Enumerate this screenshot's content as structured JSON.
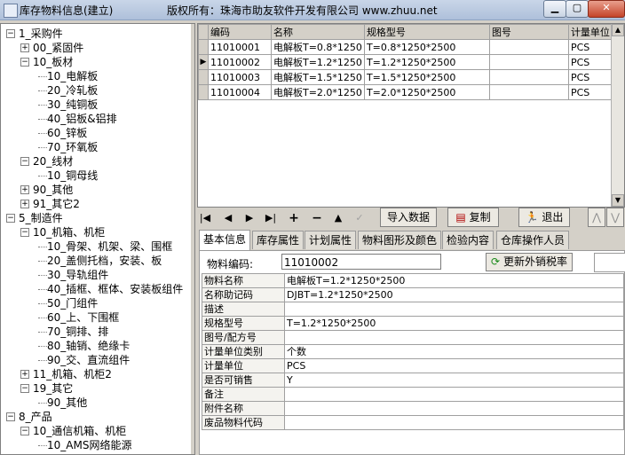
{
  "window": {
    "title": "库存物料信息(建立)",
    "copyright": "版权所有：珠海市助友软件开发有限公司 www.zhuu.net",
    "min": "▁",
    "max": "▢",
    "close": "✕"
  },
  "tree": [
    {
      "label": "1_采购件",
      "level": 0,
      "expander": "−"
    },
    {
      "label": "00_紧固件",
      "level": 1,
      "expander": "+"
    },
    {
      "label": "10_板材",
      "level": 1,
      "expander": "−"
    },
    {
      "label": "10_电解板",
      "level": 2,
      "expander": ""
    },
    {
      "label": "20_冷轧板",
      "level": 2,
      "expander": ""
    },
    {
      "label": "30_纯铜板",
      "level": 2,
      "expander": ""
    },
    {
      "label": "40_铝板&铝排",
      "level": 2,
      "expander": ""
    },
    {
      "label": "60_锌板",
      "level": 2,
      "expander": ""
    },
    {
      "label": "70_环氧板",
      "level": 2,
      "expander": ""
    },
    {
      "label": "20_线材",
      "level": 1,
      "expander": "−"
    },
    {
      "label": "10_铜母线",
      "level": 2,
      "expander": ""
    },
    {
      "label": "90_其他",
      "level": 1,
      "expander": "+"
    },
    {
      "label": "91_其它2",
      "level": 1,
      "expander": "+"
    },
    {
      "label": "5_制造件",
      "level": 0,
      "expander": "−"
    },
    {
      "label": "10_机箱、机柜",
      "level": 1,
      "expander": "−"
    },
    {
      "label": "10_骨架、机架、梁、围框",
      "level": 2,
      "expander": ""
    },
    {
      "label": "20_盖侧托档，安装、板",
      "level": 2,
      "expander": ""
    },
    {
      "label": "30_导轨组件",
      "level": 2,
      "expander": ""
    },
    {
      "label": "40_插框、框体、安装板组件",
      "level": 2,
      "expander": ""
    },
    {
      "label": "50_门组件",
      "level": 2,
      "expander": ""
    },
    {
      "label": "60_上、下围框",
      "level": 2,
      "expander": ""
    },
    {
      "label": "70_铜排、排",
      "level": 2,
      "expander": ""
    },
    {
      "label": "80_轴销、绝缘卡",
      "level": 2,
      "expander": ""
    },
    {
      "label": "90_交、直流组件",
      "level": 2,
      "expander": ""
    },
    {
      "label": "11_机箱、机柜2",
      "level": 1,
      "expander": "+"
    },
    {
      "label": "19_其它",
      "level": 1,
      "expander": "−"
    },
    {
      "label": "90_其他",
      "level": 2,
      "expander": ""
    },
    {
      "label": "8_产品",
      "level": 0,
      "expander": "−"
    },
    {
      "label": "10_通信机箱、机柜",
      "level": 1,
      "expander": "−"
    },
    {
      "label": "10_AMS网络能源",
      "level": 2,
      "expander": ""
    }
  ],
  "grid": {
    "columns": [
      "编码",
      "名称",
      "规格型号",
      "图号",
      "计量单位"
    ],
    "rows": [
      {
        "indicator": "",
        "cells": [
          "11010001",
          "电解板T=0.8*1250",
          "T=0.8*1250*2500",
          "",
          "PCS"
        ]
      },
      {
        "indicator": "▶",
        "cells": [
          "11010002",
          "电解板T=1.2*1250",
          "T=1.2*1250*2500",
          "",
          "PCS"
        ]
      },
      {
        "indicator": "",
        "cells": [
          "11010003",
          "电解板T=1.5*1250",
          "T=1.5*1250*2500",
          "",
          "PCS"
        ]
      },
      {
        "indicator": "",
        "cells": [
          "11010004",
          "电解板T=2.0*1250",
          "T=2.0*1250*2500",
          "",
          "PCS"
        ]
      }
    ]
  },
  "nav": {
    "first": "|◀",
    "prev": "◀",
    "next": "▶",
    "last": "▶|",
    "add": "+",
    "del": "−",
    "up": "▲",
    "check": "✓",
    "import": "导入数据",
    "copy": "复制",
    "exit": "退出"
  },
  "tabs": [
    "基本信息",
    "库存属性",
    "计划属性",
    "物料图形及颜色",
    "检验内容",
    "仓库操作人员"
  ],
  "detail": {
    "code_label": "物料编码:",
    "code_value": "11010002",
    "refresh_button": "更新外销税率",
    "props": [
      {
        "k": "物料名称",
        "v": "电解板T=1.2*1250*2500"
      },
      {
        "k": "名称助记码",
        "v": "DJBT=1.2*1250*2500"
      },
      {
        "k": "描述",
        "v": ""
      },
      {
        "k": "规格型号",
        "v": "T=1.2*1250*2500"
      },
      {
        "k": "图号/配方号",
        "v": ""
      },
      {
        "k": "计量单位类别",
        "v": "个数"
      },
      {
        "k": "计量单位",
        "v": "PCS"
      },
      {
        "k": "是否可销售",
        "v": "Y"
      },
      {
        "k": "备注",
        "v": ""
      },
      {
        "k": "附件名称",
        "v": ""
      },
      {
        "k": "废品物料代码",
        "v": ""
      }
    ]
  },
  "colors": {
    "selected": "#0a246a",
    "face": "#d4d0c8"
  }
}
